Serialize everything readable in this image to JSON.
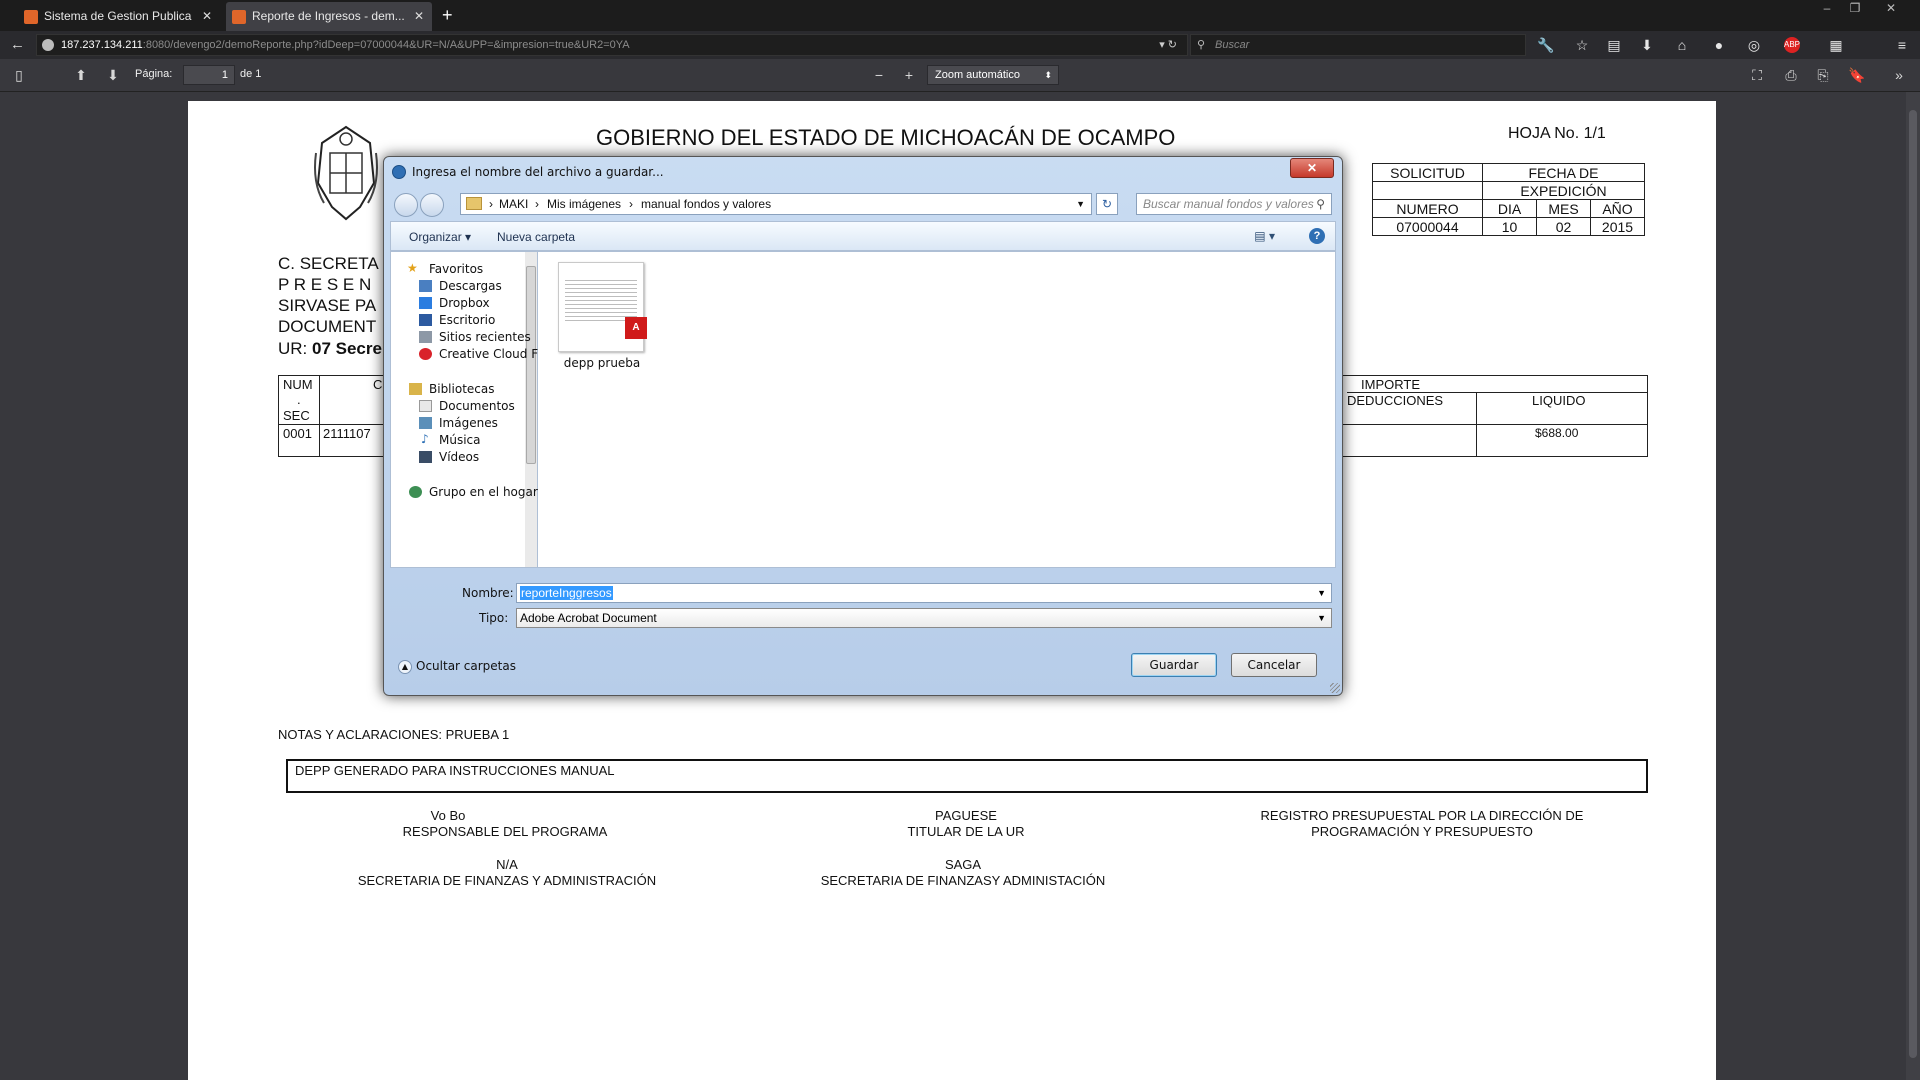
{
  "browser": {
    "tabs": [
      {
        "label": "Sistema de Gestion Publica"
      },
      {
        "label": "Reporte de Ingresos - dem..."
      }
    ],
    "url_host": "187.237.134.211",
    "url_rest": ":8080/devengo2/demoReporte.php?idDeep=07000044&UR=N/A&UPP=&impresion=true&UR2=0YA",
    "search_placeholder": "Buscar"
  },
  "pdf_toolbar": {
    "page_label": "Página:",
    "page_value": "1",
    "page_total": "de 1",
    "zoom_label": "Zoom automático"
  },
  "document": {
    "title": "GOBIERNO DEL ESTADO DE MICHOACÁN DE OCAMPO",
    "hoja": "HOJA No. 1/1",
    "solicitud": {
      "solicitud_label": "SOLICITUD",
      "fecha_label_1": "FECHA DE",
      "fecha_label_2": "EXPEDICIÓN",
      "numero_label": "NUMERO",
      "dia_label": "DIA",
      "mes_label": "MES",
      "anio_label": "AÑO",
      "numero": "07000044",
      "dia": "10",
      "mes": "02",
      "anio": "2015"
    },
    "lines": [
      "C. SECRETA",
      "P R E S E N",
      "SIRVASE PA",
      "DOCUMENT"
    ],
    "ur_prefix": "UR: ",
    "ur_value": "07 Secre",
    "table": {
      "num_header": "NUM",
      "dot": ".",
      "sec_header": "SEC",
      "c_header": "C",
      "importe_header": "IMPORTE",
      "deducciones_header": "DEDUCCIONES",
      "liquido_header": "LIQUIDO",
      "row_num": "0001",
      "row_code": "2111107",
      "row_liquido": "$688.00"
    },
    "notes_label": "NOTAS Y ACLARACIONES: PRUEBA 1",
    "notes_text": "DEPP GENERADO PARA INSTRUCCIONES MANUAL",
    "signatures": {
      "vobo": "Vo Bo",
      "responsable": "RESPONSABLE DEL PROGRAMA",
      "paguese": "PAGUESE",
      "titular": "TITULAR DE LA UR",
      "registro_1": "REGISTRO PRESUPUESTAL POR LA DIRECCIÓN DE",
      "registro_2": "PROGRAMACIÓN Y PRESUPUESTO",
      "na": "N/A",
      "sfa_1": "SECRETARIA DE FINANZAS Y ADMINISTRACIÓN",
      "saga": "SAGA",
      "sfa_2": "SECRETARIA DE FINANZASY ADMINISTACIÓN"
    }
  },
  "dialog": {
    "title": "Ingresa el nombre del archivo a guardar...",
    "close_label": "✕",
    "breadcrumb": [
      "MAKI",
      "Mis imágenes",
      "manual fondos y valores"
    ],
    "search_placeholder": "Buscar manual fondos y valores",
    "organize_label": "Organizar",
    "new_folder_label": "Nueva carpeta",
    "tree": {
      "favoritos": "Favoritos",
      "descargas": "Descargas",
      "dropbox": "Dropbox",
      "escritorio": "Escritorio",
      "sitios": "Sitios recientes",
      "creative": "Creative Cloud Fi",
      "bibliotecas": "Bibliotecas",
      "documentos": "Documentos",
      "imagenes": "Imágenes",
      "musica": "Música",
      "videos": "Vídeos",
      "grupo": "Grupo en el hogar"
    },
    "file_name": "depp prueba",
    "name_label": "Nombre:",
    "name_value": "reporteInggresos",
    "type_label": "Tipo:",
    "type_value": "Adobe Acrobat Document",
    "hide_folders_label": "Ocultar carpetas",
    "save_label": "Guardar",
    "cancel_label": "Cancelar"
  }
}
